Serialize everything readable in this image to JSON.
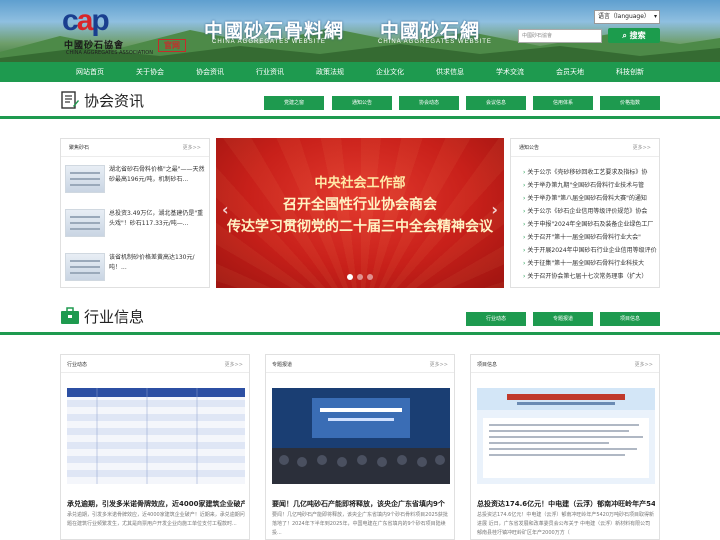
{
  "header": {
    "logo_cn": "中國砂石協會",
    "logo_en": "CHINA AGGREGATES ASSOCIATION",
    "logo_seal": "官网",
    "site1_title": "中國砂石骨料網",
    "site1_en": "CHINA AGGREGATES WEBSITE",
    "site2_title": "中國砂石網",
    "site2_en": "CHINA AGGREGATES WEBSITE",
    "lang_label": "语言（language）",
    "search_placeholder": "中國砂石協會",
    "search_button": "搜索"
  },
  "nav": [
    "网站首页",
    "关于协会",
    "协会资讯",
    "行业资讯",
    "政策法规",
    "企业文化",
    "供求信息",
    "学术交流",
    "会员天地",
    "科技创新"
  ],
  "assoc": {
    "title": "协会资讯",
    "buttons": [
      "党建之窗",
      "通知公告",
      "协会动态",
      "会议信息",
      "信用体系",
      "价格指数"
    ]
  },
  "left_box": {
    "title": "聚焦砂石",
    "more": "更多>>",
    "items": [
      {
        "line1": "湖北省砂石骨料价格\"之最\"——天然",
        "line2": "砂最高196元/吨，机制砂石..."
      },
      {
        "line1": "总投资3.49万亿，湖北基建仍是\"重",
        "line2": "头戏\"！砂石117.33元/吨—..."
      },
      {
        "line1": "该省机制砂价格差黄高达130元/",
        "line2": "吨！..."
      }
    ]
  },
  "banner": {
    "line1": "中央社会工作部",
    "line2": "召开全国性行业协会商会",
    "line3": "传达学习贯彻党的二十届三中全会精神会议"
  },
  "notice_box": {
    "title": "通知公告",
    "more": "更多>>",
    "items": [
      "关于公示《壳砂移砂回收工艺要求及指标》协",
      "关于举办第九期\"全国砂石骨料行业技术与管",
      "关于举办第\"第八届全国砂石骨料大赛\"的通知",
      "关于公示《砂石企业信用等级评价规范》协会",
      "关于申报\"2024年全国砂石及装备企业绿色工厂",
      "关于召开\"第十一届全国砂石骨料行业大会\"",
      "关于开展2024年中国砂石行业企业信用等级评价",
      "关于征集\"第十一届全国砂石骨料行业科技大",
      "关于召开协会第七届十七次常务理事（扩大）"
    ]
  },
  "industry": {
    "title": "行业信息",
    "buttons": [
      "行业动态",
      "专题报道",
      "项目信息"
    ]
  },
  "cards": [
    {
      "title": "行业动态",
      "more": "更多>>",
      "headline": "承兑逾期，引发多米诺骨牌效应，近4000家建筑企业破产",
      "desc": "承兑逾期，引发多米诺骨牌效应，近4000家建筑企业破产！近期来，承兑逾期问题在建筑行业频繁发生，尤其是商票用户开发企业向施工单位支付工程款时..."
    },
    {
      "title": "专题报道",
      "more": "更多>>",
      "headline": "要闻！几亿吨砂石产能即将释放，该央企广东省填内9个",
      "desc": "要闻！几亿吨砂石产能即将释放，该央企广东省填内9个砂石骨料项目2025获批落地了！2024年下半年到2025年，中国电建在广东省填内的9个砂石项目陆续投..."
    },
    {
      "title": "项目信息",
      "more": "更多>>",
      "headline": "总投资达174.6亿元！中电建（云浮）郁南冲旺岭年产542",
      "desc": "总投资达174.6亿元！中电建（云浮）郁南冲旺岭年产5420万吨砂石项目取得新进展 近日，广东省发展和改革委员会公布关于 中电建（云浮）新材料有限公司郁南县桂圩镇冲旺岭矿区年产2000万方（"
    }
  ],
  "colors": {
    "green": "#1e9a4f",
    "banner_red": "#c8201a"
  }
}
